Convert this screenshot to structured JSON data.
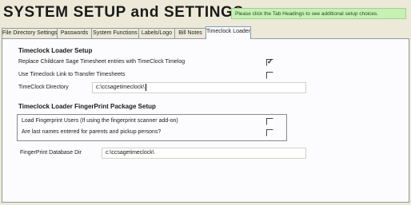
{
  "app": {
    "title": "SYSTEM SETUP and SETTINGS"
  },
  "hint": "Please click the Tab Headings to see additional setup choices.",
  "tabs": [
    {
      "label": "File Directory Settings"
    },
    {
      "label": "Passwords"
    },
    {
      "label": "System Functions"
    },
    {
      "label": "Labels/Logo"
    },
    {
      "label": "Bill Notes"
    },
    {
      "label": "Timeclock Loader"
    }
  ],
  "timeclock_setup": {
    "title": "Timeclock Loader Setup",
    "replace_label": "Replace Childcare Sage Timesheet entries with TimeClock Timelog",
    "replace_checked": true,
    "transfer_label": "Use Timeclock Link to Transfer Timesheets",
    "transfer_checked": false,
    "directory_label": "TimeClock Directory",
    "directory_value": "c:\\ccsagetimeclock\\"
  },
  "fingerprint_setup": {
    "title": "Timeclock Loader FingerPrint Package Setup",
    "load_users_label": "Load Fingerprint Users (If using the fingerprint scanner add-on)",
    "load_users_checked": false,
    "last_names_label": "Are last names entered for parents and pickup persons?",
    "last_names_checked": false,
    "db_dir_label": "FingerPrint Database Dir",
    "db_dir_value": "c:\\ccsagetimeclock\\"
  }
}
